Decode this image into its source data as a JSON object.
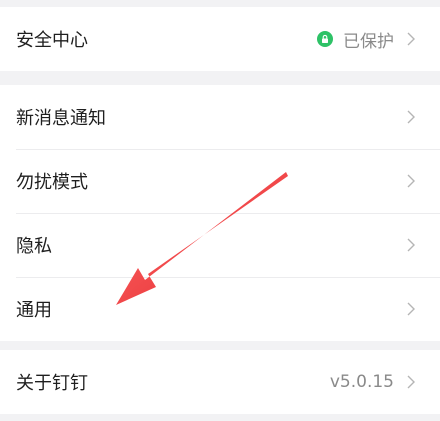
{
  "security": {
    "label": "安全中心",
    "status": "已保护",
    "colors": {
      "shield": "#2ec267"
    },
    "icon": "lock-icon"
  },
  "menu": {
    "items": [
      {
        "label": "新消息通知"
      },
      {
        "label": "勿扰模式"
      },
      {
        "label": "隐私"
      },
      {
        "label": "通用"
      }
    ]
  },
  "about": {
    "label": "关于钉钉",
    "version": "v5.0.15"
  },
  "annotation": {
    "arrow_color": "#e8383b"
  },
  "icons": {
    "chevron": "chevron-right-icon"
  }
}
